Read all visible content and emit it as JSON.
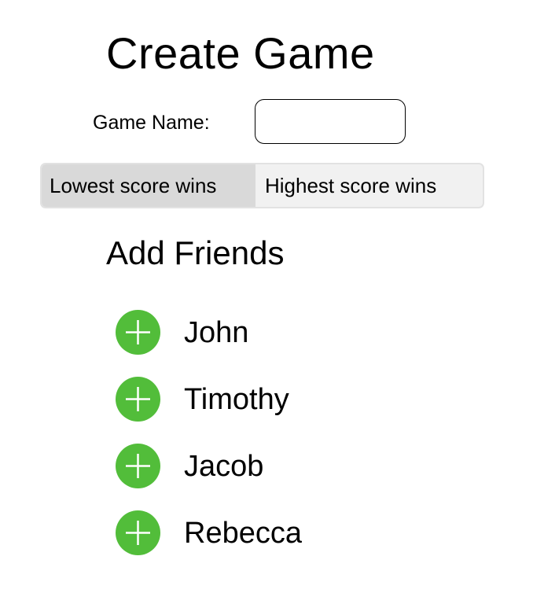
{
  "header": {
    "title": "Create Game"
  },
  "game_name": {
    "label": "Game Name:",
    "value": "",
    "placeholder": ""
  },
  "scoring": {
    "options": [
      {
        "label": "Lowest score wins",
        "selected": true
      },
      {
        "label": "Highest score wins",
        "selected": false
      }
    ]
  },
  "friends": {
    "title": "Add Friends",
    "items": [
      {
        "name": "John",
        "icon": "plus-icon"
      },
      {
        "name": "Timothy",
        "icon": "plus-icon"
      },
      {
        "name": "Jacob",
        "icon": "plus-icon"
      },
      {
        "name": "Rebecca",
        "icon": "plus-icon"
      }
    ]
  },
  "colors": {
    "accent_green": "#52bd3a",
    "segment_selected": "#d9d9d9",
    "segment_background": "#f1f1f1"
  }
}
